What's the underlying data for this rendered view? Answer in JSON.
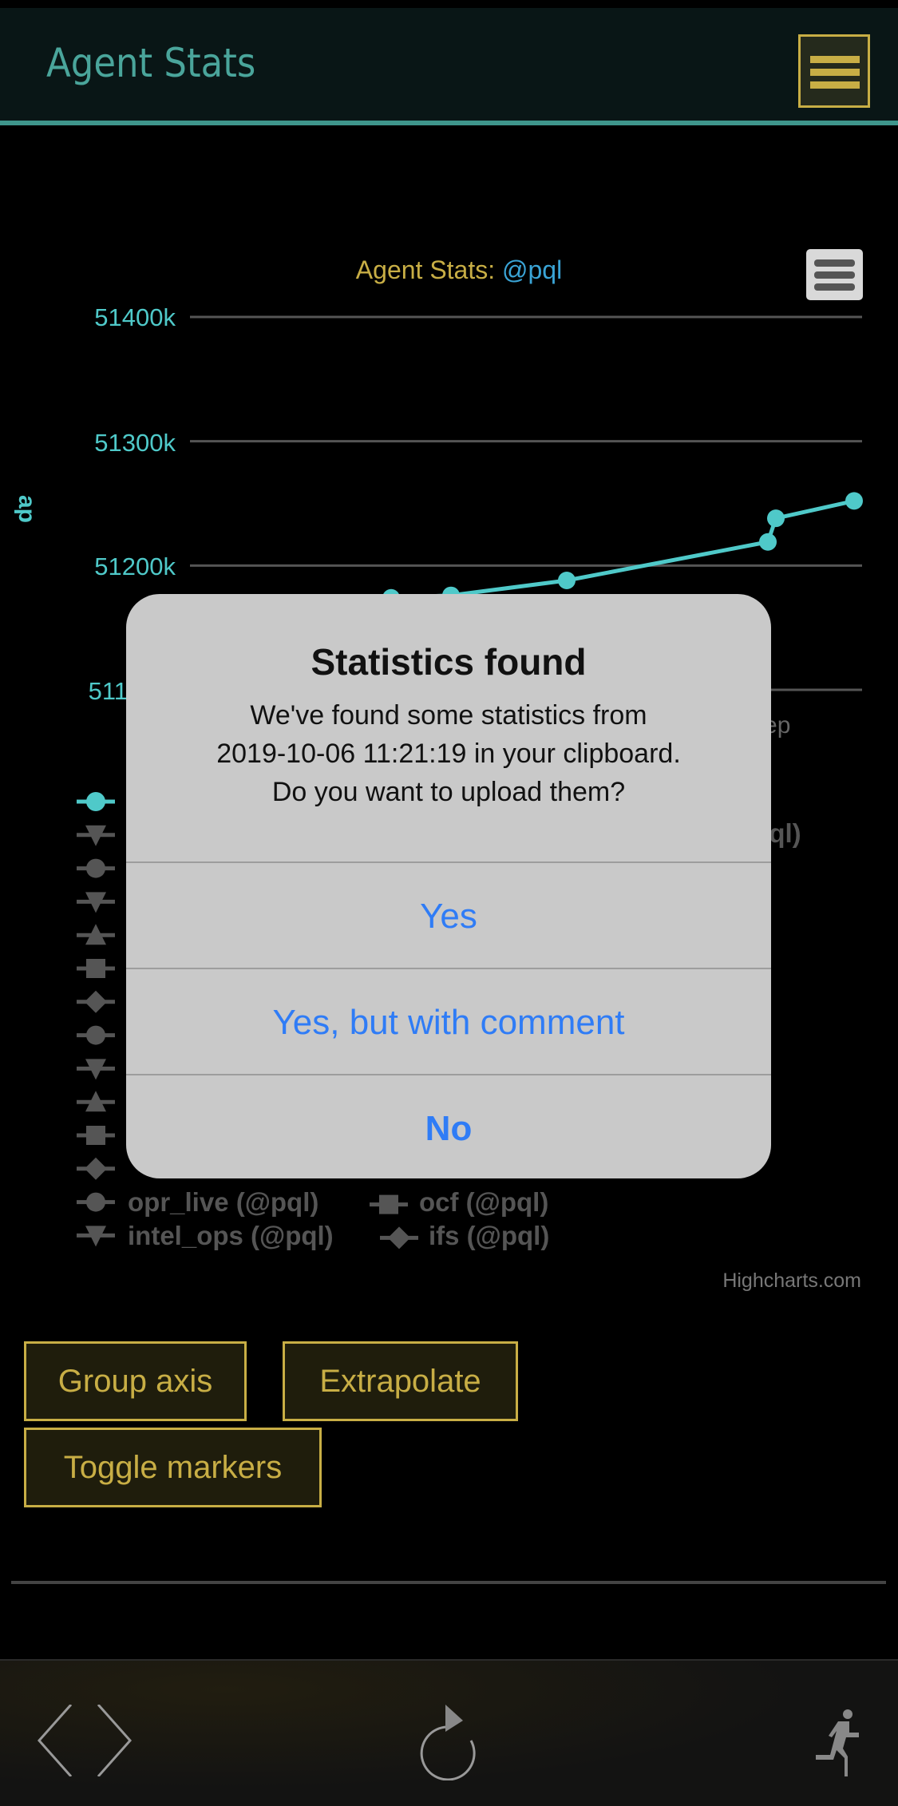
{
  "header": {
    "title": "Agent Stats",
    "menu_icon": "hamburger-icon"
  },
  "chart": {
    "title_prefix": "Agent Stats:",
    "title_agent": "@pql",
    "export_icon": "hamburger-icon",
    "credits": "Highcharts.com",
    "x_tick_partial": "ep",
    "legend_visible": [
      {
        "label": "opr_live (@pql)",
        "marker": "circle"
      },
      {
        "label": "ocf (@pql)",
        "marker": "square"
      },
      {
        "label": "intel_ops (@pql)",
        "marker": "triangle-down"
      },
      {
        "label": "ifs (@pql)",
        "marker": "diamond"
      },
      {
        "label": "(@pql)",
        "marker": ""
      }
    ]
  },
  "chart_data": {
    "type": "line",
    "ylabel": "ap",
    "ytick_labels": [
      "51400k",
      "51300k",
      "51200k",
      "511"
    ],
    "ylim": [
      51100,
      51400
    ],
    "y_unit": "k",
    "grid": true,
    "series": [
      {
        "color": "#4fc9c9",
        "values": [
          51174,
          51176,
          51188,
          51219,
          51238,
          51252
        ]
      }
    ],
    "legend_markers": [
      "circle",
      "triangle-down",
      "circle",
      "triangle-down",
      "triangle-up",
      "square",
      "diamond",
      "circle",
      "triangle-down",
      "triangle-up",
      "square",
      "diamond",
      "circle",
      "triangle-down"
    ]
  },
  "buttons": {
    "group_axis": "Group axis",
    "extrapolate": "Extrapolate",
    "toggle_markers": "Toggle markers"
  },
  "dialog": {
    "title": "Statistics found",
    "body": [
      "We've found some statistics from",
      "2019-10-06 11:21:19 in your clipboard.",
      "Do you want to upload them?"
    ],
    "yes": "Yes",
    "yes_comment": "Yes, but with comment",
    "no": "No"
  },
  "bottom_bar": {
    "icons": [
      "back-icon",
      "forward-icon",
      "refresh-icon",
      "exit-runner-icon"
    ]
  },
  "colors": {
    "accent_gold": "#c8ae45",
    "accent_teal": "#4aa59b",
    "series": "#4fc9c9",
    "dialog_button": "#2f7cf6"
  }
}
